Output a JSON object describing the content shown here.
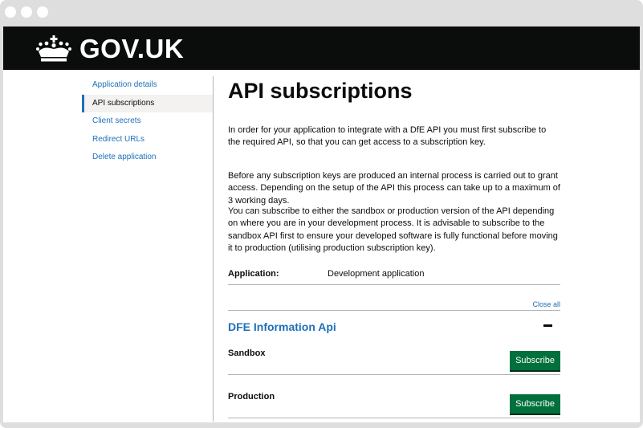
{
  "header": {
    "logo_text": "GOV.UK",
    "crown_icon": "crown-icon"
  },
  "sidebar": {
    "items": [
      {
        "label": "Application details",
        "active": false
      },
      {
        "label": "API subscriptions",
        "active": true
      },
      {
        "label": "Client secrets",
        "active": false
      },
      {
        "label": "Redirect URLs",
        "active": false
      },
      {
        "label": "Delete application",
        "active": false
      }
    ]
  },
  "main": {
    "title": "API subscriptions",
    "paragraphs": [
      "In order for your application to integrate with a DfE API you must first subscribe to the required API, so that you can get access to a subscription key.",
      "Before any subscription keys are produced an internal process is carried out to grant access. Depending on the setup of the API this process can take up to a maximum of 3 working days.",
      "You can subscribe to either the sandbox or production version of the API depending on where you are in your development process. It is advisable to subscribe to the sandbox API first to ensure your developed software is fully functional before moving it to production (utilising production subscription key)."
    ],
    "summary": {
      "key": "Application:",
      "value": "Development application"
    },
    "close_all_label": "Close all",
    "accordion": {
      "heading": "DFE Information Api",
      "toggle_icon": "minus-icon",
      "rows": [
        {
          "label": "Sandbox",
          "button": "Subscribe"
        },
        {
          "label": "Production",
          "button": "Subscribe"
        }
      ]
    }
  },
  "colors": {
    "header_bg": "#0b0c0c",
    "link": "#1d70b8",
    "button": "#00703c",
    "border": "#b1b4b6",
    "frame": "#dedede"
  }
}
